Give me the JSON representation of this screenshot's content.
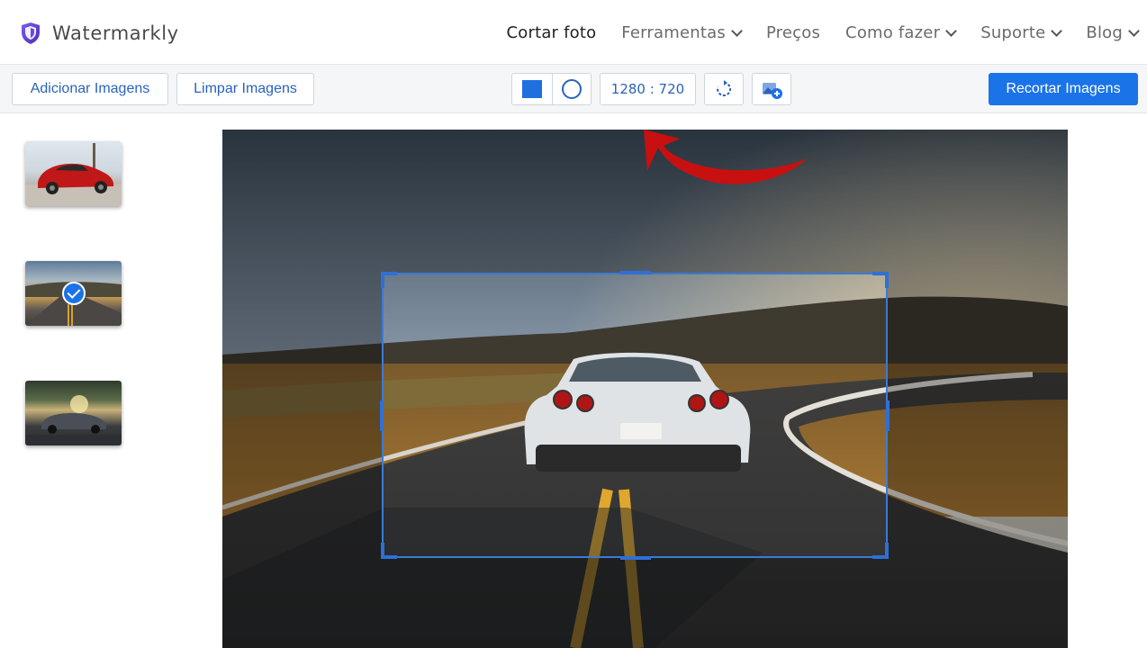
{
  "header": {
    "logo_text": "Watermarkly",
    "nav": [
      {
        "label": "Cortar foto",
        "dropdown": false,
        "active": true
      },
      {
        "label": "Ferramentas",
        "dropdown": true,
        "active": false
      },
      {
        "label": "Preços",
        "dropdown": false,
        "active": false
      },
      {
        "label": "Como fazer",
        "dropdown": true,
        "active": false
      },
      {
        "label": "Suporte",
        "dropdown": true,
        "active": false
      },
      {
        "label": "Blog",
        "dropdown": true,
        "active": false
      }
    ]
  },
  "toolbar": {
    "add_images_label": "Adicionar Imagens",
    "clear_images_label": "Limpar Imagens",
    "shape_options": [
      "rectangle",
      "circle"
    ],
    "selected_shape": "rectangle",
    "aspect_ratio": "1280 : 720",
    "rotate_icon": "rotate-icon",
    "add_image_icon": "add-image-icon",
    "crop_images_label": "Recortar Imagens"
  },
  "thumbnails": [
    {
      "name": "red-sports-car",
      "selected": false
    },
    {
      "name": "road-white-car",
      "selected": true
    },
    {
      "name": "dark-car-trees",
      "selected": false
    }
  ],
  "colors": {
    "accent": "#1a73e8",
    "button_text": "#2a63b8",
    "arrow": "#cc1414",
    "logo": "#6a4bd8"
  }
}
